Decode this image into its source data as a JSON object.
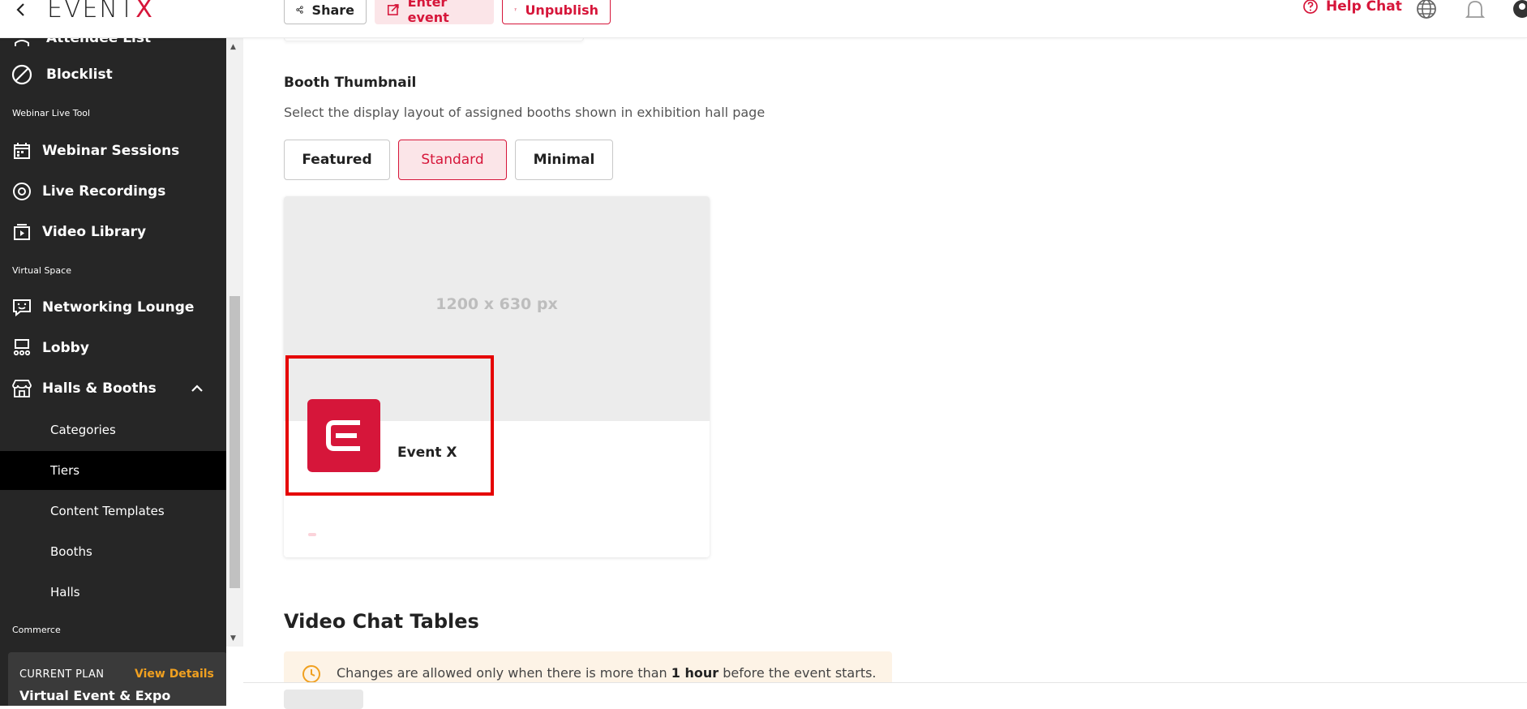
{
  "header": {
    "logo_text": "EVENT",
    "logo_accent": "X",
    "share_label": "Share",
    "enter_event_label": "Enter event",
    "unpublish_label": "Unpublish",
    "help_chat_label": "Help Chat"
  },
  "sidebar": {
    "partial_item": "Attendee List",
    "blocklist": "Blocklist",
    "section_webinar": "Webinar Live Tool",
    "webinar_sessions": "Webinar Sessions",
    "live_recordings": "Live Recordings",
    "video_library": "Video Library",
    "section_virtual": "Virtual Space",
    "networking_lounge": "Networking Lounge",
    "lobby": "Lobby",
    "halls_booths": "Halls & Booths",
    "sub_items": [
      "Categories",
      "Tiers",
      "Content Templates",
      "Booths",
      "Halls"
    ],
    "active_sub": "Tiers",
    "section_commerce": "Commerce",
    "plan_label": "CURRENT PLAN",
    "plan_link": "View Details",
    "plan_name": "Virtual Event & Expo"
  },
  "main": {
    "booth_thumbnail_title": "Booth Thumbnail",
    "booth_thumbnail_desc": "Select the display layout of assigned booths shown in exhibition hall page",
    "layout_options": [
      "Featured",
      "Standard",
      "Minimal"
    ],
    "selected_layout": "Standard",
    "preview_placeholder": "1200 x 630 px",
    "booth_name": "Event X",
    "video_chat_title": "Video Chat Tables",
    "notice_pre": "Changes are allowed only when there is more than ",
    "notice_bold": "1 hour",
    "notice_post": " before the event starts."
  },
  "colors": {
    "brand": "#d6163a",
    "sidebar_bg": "#262626",
    "highlight_box": "#e50000",
    "plan_link": "#f0a020"
  }
}
